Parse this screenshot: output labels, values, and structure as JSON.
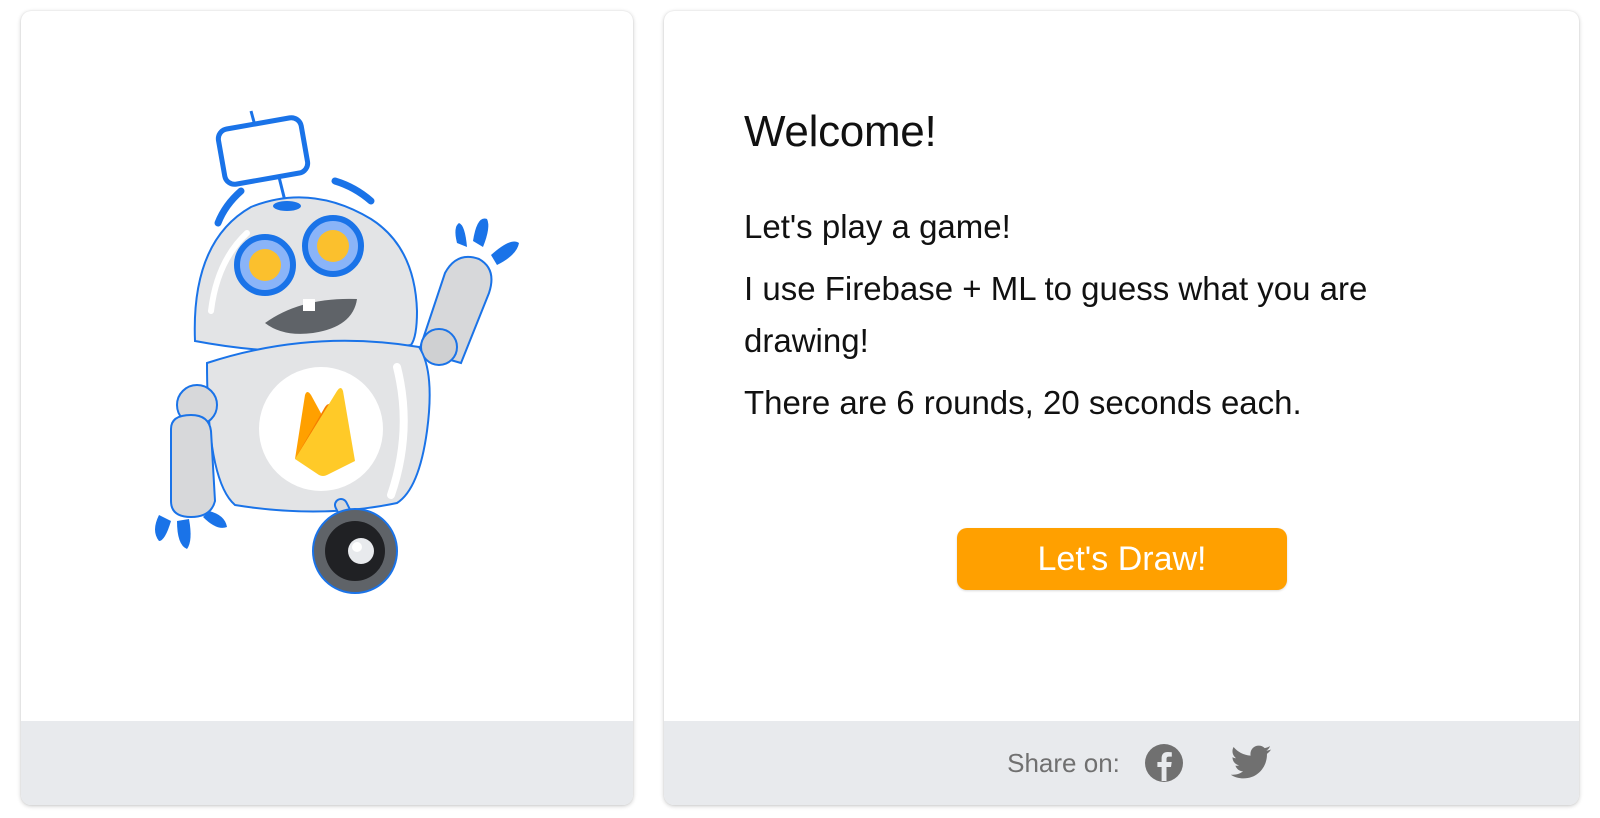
{
  "welcome": {
    "title": "Welcome!",
    "lines": [
      "Let's play a game!",
      "I use Firebase + ML to guess what you are drawing!",
      "There are 6 rounds, 20 seconds each."
    ],
    "button_label": "Let's Draw!"
  },
  "share": {
    "label": "Share on:",
    "icons": [
      "facebook-icon",
      "twitter-icon"
    ]
  },
  "illustration": {
    "icons": [
      "robot-mascot",
      "firebase-logo"
    ]
  },
  "colors": {
    "accent": "#ffa000",
    "footer": "#e8eaed",
    "robot_blue": "#1a73e8",
    "robot_eye": "#fbc02d"
  }
}
